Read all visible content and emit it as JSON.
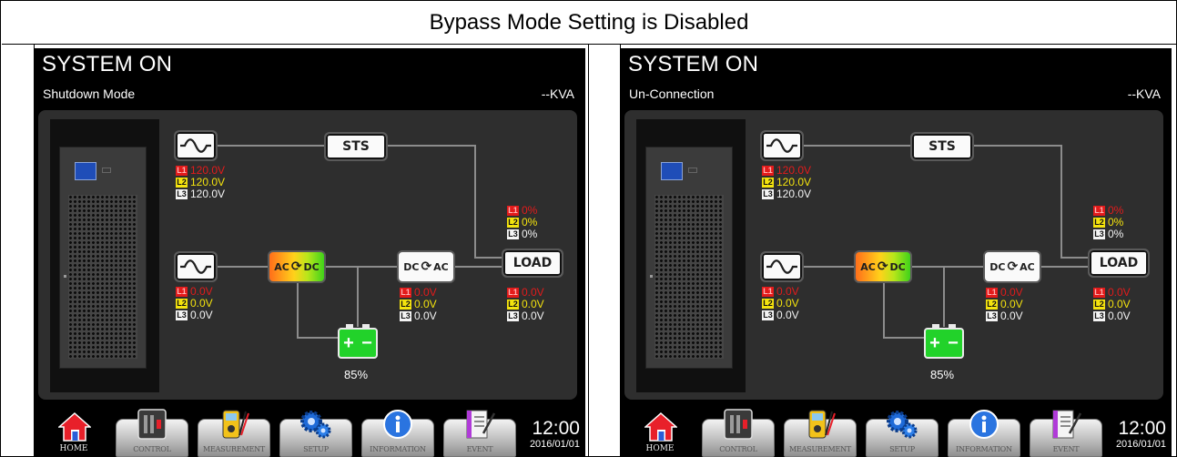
{
  "caption": "Bypass Mode Setting is Disabled",
  "colors": {
    "screen_bg": "#000000",
    "diagram_bg": "#2e2e2e",
    "l1": "#e31b1b",
    "l2": "#f4e30e",
    "l3": "#f4f4f4",
    "battery": "#22d22a"
  },
  "panels": [
    {
      "title": "SYSTEM ON",
      "mode": "Shutdown Mode",
      "kva": "--KVA",
      "bypass": {
        "icon": "sine-wave-icon",
        "l1": "120.0V",
        "l2": "120.0V",
        "l3": "120.0V"
      },
      "sts_label": "STS",
      "main_input": {
        "icon": "sine-wave-icon",
        "l1": "0.0V",
        "l2": "0.0V",
        "l3": "0.0V"
      },
      "rectifier": {
        "left": "AC",
        "right": "DC"
      },
      "inverter": {
        "left": "DC",
        "right": "AC",
        "l1": "0.0V",
        "l2": "0.0V",
        "l3": "0.0V"
      },
      "load": {
        "label": "LOAD",
        "pct_l1": "0%",
        "pct_l2": "0%",
        "pct_l3": "0%",
        "l1": "0.0V",
        "l2": "0.0V",
        "l3": "0.0V"
      },
      "battery": {
        "plus": "+",
        "minus": "−",
        "percent": "85%",
        "level": 0.85
      },
      "nav": {
        "home": "HOME",
        "control": "CONTROL",
        "measurement": "MEASUREMENT",
        "setup": "SETUP",
        "information": "INFORMATION",
        "event": "EVENT"
      },
      "clock": {
        "time": "12:00",
        "date": "2016/01/01"
      }
    },
    {
      "title": "SYSTEM ON",
      "mode": "Un-Connection",
      "kva": "--KVA",
      "bypass": {
        "icon": "sine-wave-icon",
        "l1": "120.0V",
        "l2": "120.0V",
        "l3": "120.0V"
      },
      "sts_label": "STS",
      "main_input": {
        "icon": "sine-wave-icon",
        "l1": "0.0V",
        "l2": "0.0V",
        "l3": "0.0V"
      },
      "rectifier": {
        "left": "AC",
        "right": "DC"
      },
      "inverter": {
        "left": "DC",
        "right": "AC",
        "l1": "0.0V",
        "l2": "0.0V",
        "l3": "0.0V"
      },
      "load": {
        "label": "LOAD",
        "pct_l1": "0%",
        "pct_l2": "0%",
        "pct_l3": "0%",
        "l1": "0.0V",
        "l2": "0.0V",
        "l3": "0.0V"
      },
      "battery": {
        "plus": "+",
        "minus": "−",
        "percent": "85%",
        "level": 0.85
      },
      "nav": {
        "home": "HOME",
        "control": "CONTROL",
        "measurement": "MEASUREMENT",
        "setup": "SETUP",
        "information": "INFORMATION",
        "event": "EVENT"
      },
      "clock": {
        "time": "12:00",
        "date": "2016/01/01"
      }
    }
  ]
}
